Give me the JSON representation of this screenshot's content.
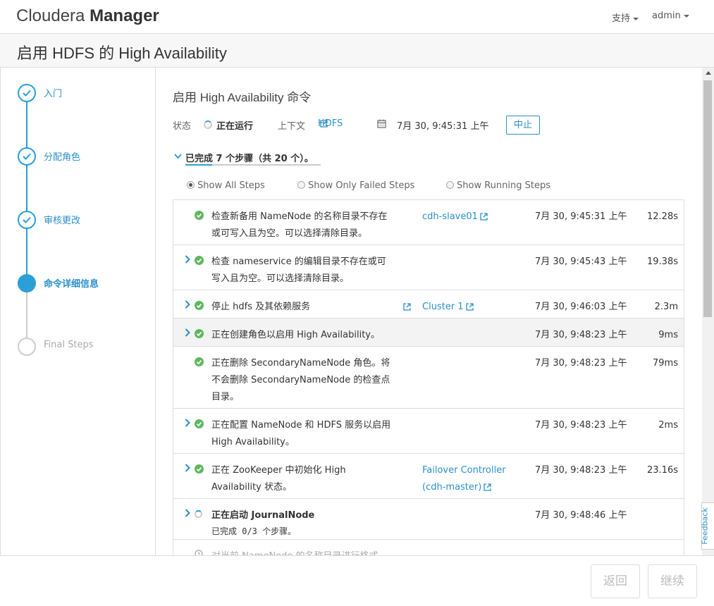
{
  "header": {
    "brand_light": "Cloudera",
    "brand_bold": "Manager",
    "support_label": "支持",
    "user_label": "admin"
  },
  "page_title": "启用 HDFS 的 High Availability",
  "wizard_steps": [
    {
      "label": "入门",
      "state": "done"
    },
    {
      "label": "分配角色",
      "state": "done"
    },
    {
      "label": "审核更改",
      "state": "done"
    },
    {
      "label": "命令详细信息",
      "state": "active"
    },
    {
      "label": "Final Steps",
      "state": "pending"
    }
  ],
  "command": {
    "title": "启用 High Availability 命令",
    "status_label": "状态",
    "status_value": "正在运行",
    "context_label": "上下文",
    "context_value": "HDFS",
    "timestamp": "7月 30, 9:45:31 上午",
    "stop_label": "中止"
  },
  "progress": {
    "text": "已完成 7 个步骤（共 20 个）。",
    "completed": 7,
    "total": 20
  },
  "filters": [
    {
      "label": "Show All Steps",
      "selected": true
    },
    {
      "label": "Show Only Failed Steps",
      "selected": false
    },
    {
      "label": "Show Running Steps",
      "selected": false
    }
  ],
  "steps": [
    {
      "desc": "检查新备用 NameNode 的名称目录不存在或可写入且为空。可以选择清除目录。",
      "host": "cdh-slave01",
      "time": "7月 30, 9:45:31 上午",
      "duration": "12.28s",
      "status": "ok",
      "expandable": false,
      "has_link": false
    },
    {
      "desc": "检查 nameservice 的编辑目录不存在或可写入且为空。可以选择清除目录。",
      "host": "",
      "time": "7月 30, 9:45:43 上午",
      "duration": "19.38s",
      "status": "ok",
      "expandable": true,
      "has_link": false
    },
    {
      "desc": "停止 hdfs 及其依赖服务",
      "host": "Cluster 1",
      "time": "7月 30, 9:46:03 上午",
      "duration": "2.3m",
      "status": "ok",
      "expandable": true,
      "has_link": true
    },
    {
      "desc": "正在创建角色以启用 High Availability。",
      "host": "",
      "time": "7月 30, 9:48:23 上午",
      "duration": "9ms",
      "status": "ok",
      "expandable": true,
      "has_link": false
    },
    {
      "desc": "正在删除 SecondaryNameNode 角色。将不会删除 SecondaryNameNode 的检查点目录。",
      "host": "",
      "time": "7月 30, 9:48:23 上午",
      "duration": "79ms",
      "status": "ok",
      "expandable": false,
      "has_link": false
    },
    {
      "desc": "正在配置 NameNode 和 HDFS 服务以启用 High Availability。",
      "host": "",
      "time": "7月 30, 9:48:23 上午",
      "duration": "2ms",
      "status": "ok",
      "expandable": true,
      "has_link": false
    },
    {
      "desc": "正在 ZooKeeper 中初始化 High Availability 状态。",
      "host": "Failover Controller (cdh-master)",
      "time": "7月 30, 9:48:23 上午",
      "duration": "23.16s",
      "status": "ok",
      "expandable": true,
      "has_link": false
    },
    {
      "desc": "正在启动 JournalNode",
      "sub": "已完成 0/3 个步骤。",
      "host": "",
      "time": "7月 30, 9:48:46 上午",
      "duration": "",
      "status": "running",
      "expandable": true,
      "has_link": false
    },
    {
      "desc": "对当前 NameNode 的名称目录进行格式",
      "host": "",
      "time": "",
      "duration": "",
      "status": "pending",
      "expandable": false,
      "has_link": false
    }
  ],
  "feedback_label": "Feedback",
  "footer": {
    "back_label": "返回",
    "continue_label": "继续"
  },
  "colors": {
    "accent": "#2a9fd8",
    "success": "#5cb85c"
  }
}
